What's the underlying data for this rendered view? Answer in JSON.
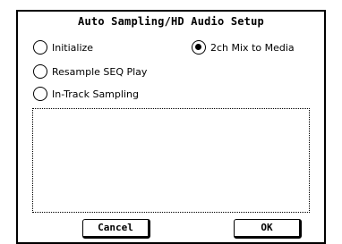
{
  "dialog": {
    "title": "Auto Sampling/HD Audio Setup",
    "options": [
      {
        "label": "Initialize",
        "selected": false
      },
      {
        "label": "2ch Mix to Media",
        "selected": true
      },
      {
        "label": "Resample SEQ Play",
        "selected": false
      },
      {
        "label": "In-Track Sampling",
        "selected": false
      }
    ],
    "message": "",
    "cancel_label": "Cancel",
    "ok_label": "OK"
  }
}
